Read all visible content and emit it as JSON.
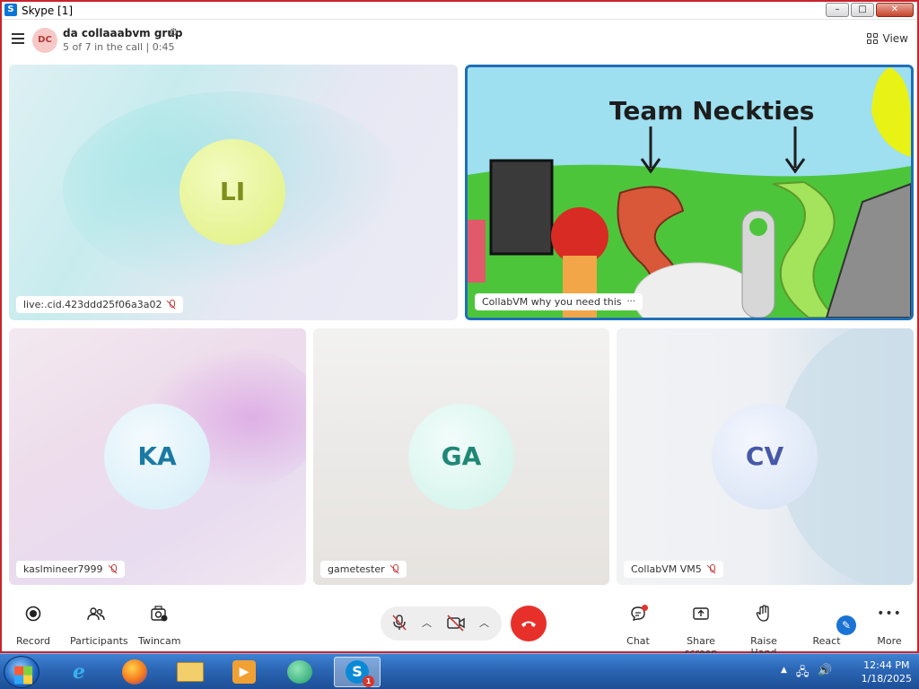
{
  "window": {
    "title": "Skype [1]",
    "app_icon": "S",
    "controls": [
      "–",
      "□",
      "✕"
    ]
  },
  "header": {
    "avatar_initials": "DC",
    "group_name": "da collaaabvm grup",
    "status": "5 of 7 in the call | 0:45",
    "view_label": "View"
  },
  "tiles": [
    {
      "initials": "LI",
      "name": "live:.cid.423ddd25f06a3a02",
      "muted": true
    },
    {
      "initials": "",
      "name": "CollabVM why you need this",
      "sharing": true,
      "more": "···",
      "share_text": "Team Neckties"
    },
    {
      "initials": "KA",
      "name": "kaslmineer7999",
      "muted": true
    },
    {
      "initials": "GA",
      "name": "gametester",
      "muted": true
    },
    {
      "initials": "CV",
      "name": "CollabVM VM5",
      "muted": true
    }
  ],
  "toolbar": {
    "record": "Record",
    "participants": "Participants",
    "twincam": "Twincam",
    "chat": "Chat",
    "share_screen": "Share screen",
    "raise_hand": "Raise Hand",
    "react": "React",
    "more": "More",
    "hangup_icon": "phone-hangup-icon",
    "mic_state": "muted",
    "camera_state": "off"
  },
  "taskbar": {
    "time": "12:44 PM",
    "date": "1/18/2025",
    "skype_badge": "1",
    "tray_arrow": "▲",
    "accent": "#2b66b4"
  },
  "colors": {
    "hangup": "#e8302a",
    "active_border": "#1f6fb8",
    "window_border": "#c8232c"
  }
}
